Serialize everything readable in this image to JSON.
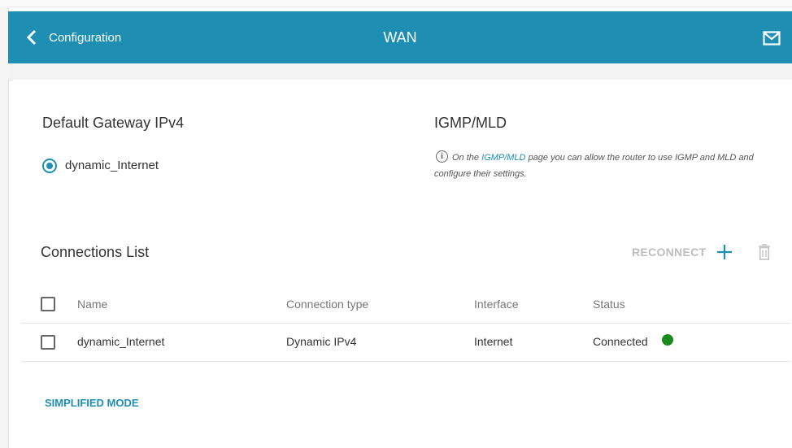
{
  "header": {
    "back_label": "Configuration",
    "title": "WAN",
    "mail_icon": "mail-icon",
    "back_icon": "chevron-left-icon"
  },
  "gateway": {
    "title": "Default Gateway IPv4",
    "selected": "dynamic_Internet"
  },
  "igmp": {
    "title": "IGMP/MLD",
    "note_prefix": "On the",
    "note_link": "IGMP/MLD",
    "note_suffix": "page you can allow the router to use IGMP and MLD and configure their settings."
  },
  "connections": {
    "title": "Connections List",
    "reconnect_label": "RECONNECT",
    "columns": [
      "Name",
      "Connection type",
      "Interface",
      "Status"
    ],
    "rows": [
      {
        "name": "dynamic_Internet",
        "type": "Dynamic IPv4",
        "interface": "Internet",
        "status": "Connected",
        "status_color": "#1a8a1a"
      }
    ]
  },
  "footer": {
    "simplified_label": "SIMPLIFIED MODE"
  },
  "colors": {
    "accent": "#1e8fb3",
    "connected": "#1a8a1a"
  }
}
